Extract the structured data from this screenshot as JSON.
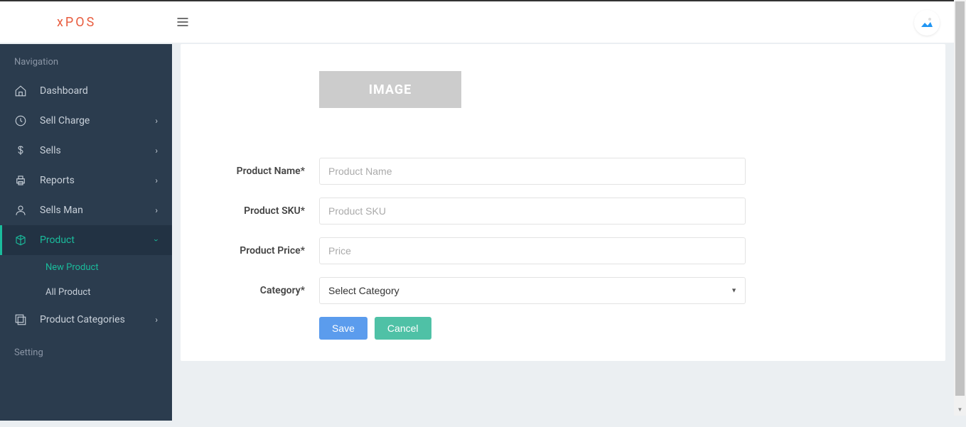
{
  "logo": "xPOS",
  "sidebar": {
    "nav_header": "Navigation",
    "setting_header": "Setting",
    "items": [
      {
        "label": "Dashboard"
      },
      {
        "label": "Sell Charge"
      },
      {
        "label": "Sells"
      },
      {
        "label": "Reports"
      },
      {
        "label": "Sells Man"
      },
      {
        "label": "Product"
      },
      {
        "label": "Product Categories"
      }
    ],
    "product_sub": [
      {
        "label": "New Product"
      },
      {
        "label": "All Product"
      }
    ]
  },
  "form": {
    "image_label": "IMAGE",
    "product_name": {
      "label": "Product Name*",
      "placeholder": "Product Name"
    },
    "product_sku": {
      "label": "Product SKU*",
      "placeholder": "Product SKU"
    },
    "product_price": {
      "label": "Product Price*",
      "placeholder": "Price"
    },
    "category": {
      "label": "Category*",
      "selected": "Select Category"
    },
    "save_label": "Save",
    "cancel_label": "Cancel"
  }
}
